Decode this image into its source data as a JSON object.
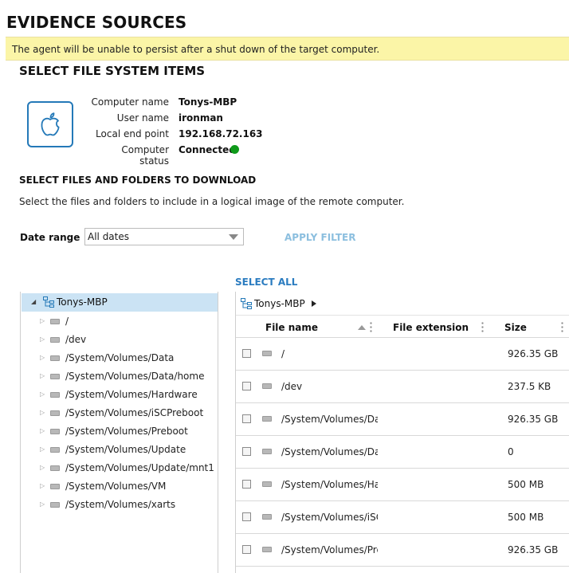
{
  "page_title": "EVIDENCE SOURCES",
  "warning": "The agent will be unable to persist after a shut down of the target computer.",
  "section_title": "SELECT FILE SYSTEM ITEMS",
  "device_info": {
    "icon": "apple-icon",
    "rows": [
      {
        "label": "Computer name",
        "value": "Tonys-MBP"
      },
      {
        "label": "User name",
        "value": "ironman"
      },
      {
        "label": "Local end point",
        "value": "192.168.72.163"
      },
      {
        "label": "Computer status",
        "value": "Connected"
      }
    ],
    "status_color": "#0f9a1a"
  },
  "download": {
    "title": "SELECT FILES AND FOLDERS TO DOWNLOAD",
    "description": "Select the files and folders to include in a logical image of the remote computer."
  },
  "filter": {
    "date_range_label": "Date range",
    "date_range_value": "All dates",
    "apply_label": "APPLY FILTER"
  },
  "select_all_label": "SELECT ALL",
  "tree": {
    "root": "Tonys-MBP",
    "items": [
      "/",
      "/dev",
      "/System/Volumes/Data",
      "/System/Volumes/Data/home",
      "/System/Volumes/Hardware",
      "/System/Volumes/iSCPreboot",
      "/System/Volumes/Preboot",
      "/System/Volumes/Update",
      "/System/Volumes/Update/mnt1",
      "/System/Volumes/VM",
      "/System/Volumes/xarts"
    ]
  },
  "grid": {
    "breadcrumb": "Tonys-MBP",
    "columns": {
      "name": "File name",
      "extension": "File extension",
      "size": "Size"
    },
    "rows": [
      {
        "name": "/",
        "extension": "",
        "size": "926.35 GB"
      },
      {
        "name": "/dev",
        "extension": "",
        "size": "237.5 KB"
      },
      {
        "name": "/System/Volumes/Data",
        "extension": "",
        "size": "926.35 GB"
      },
      {
        "name": "/System/Volumes/Data/home",
        "extension": "",
        "size": "0"
      },
      {
        "name": "/System/Volumes/Hardware",
        "extension": "",
        "size": "500 MB"
      },
      {
        "name": "/System/Volumes/iSCPreboot",
        "extension": "",
        "size": "500 MB"
      },
      {
        "name": "/System/Volumes/Preboot",
        "extension": "",
        "size": "926.35 GB"
      }
    ]
  },
  "colors": {
    "warning_bg": "#fbf5a7",
    "selection_bg": "#cbe3f4",
    "link": "#2b7cc0",
    "link_disabled": "#8cbfdf",
    "icon_blue": "#2479b8"
  }
}
